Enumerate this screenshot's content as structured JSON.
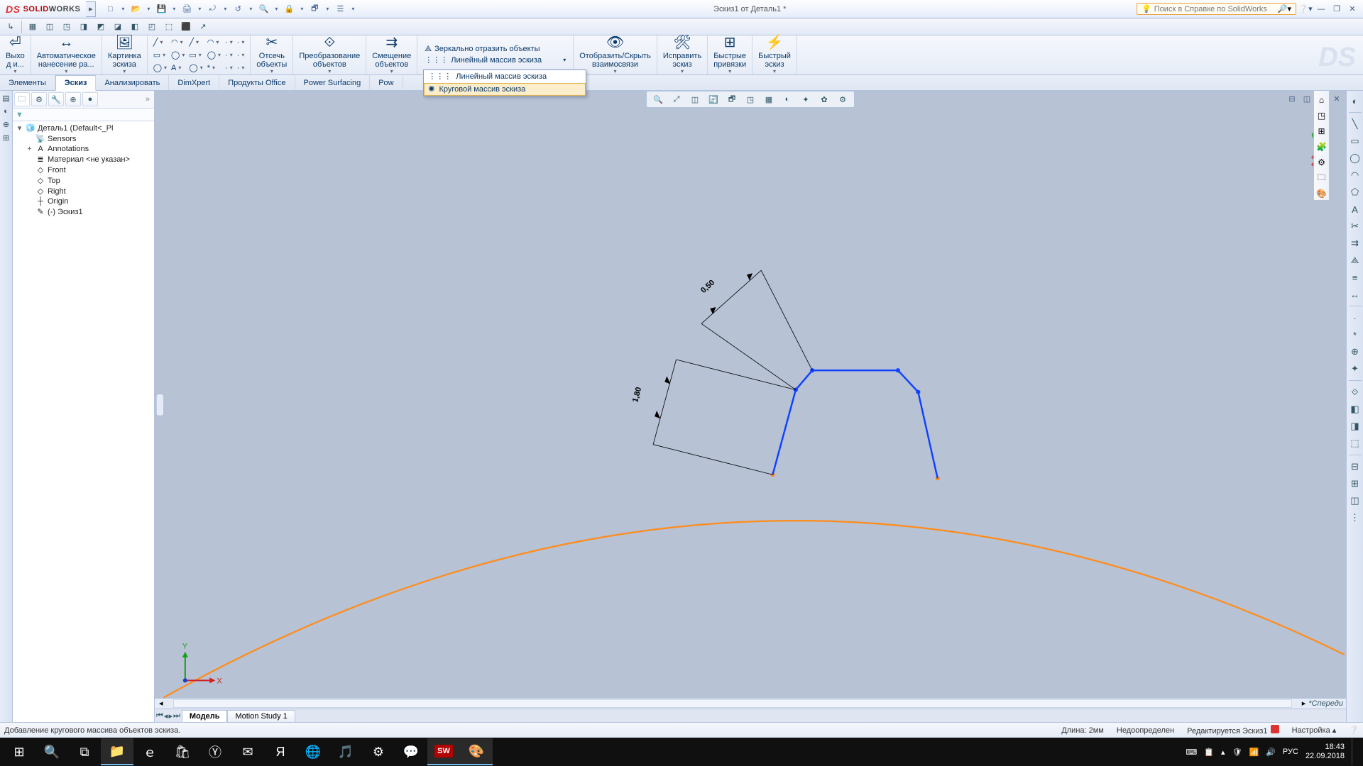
{
  "app": {
    "name_a": "SOLID",
    "name_b": "WORKS",
    "doc": "Эскиз1 от Деталь1 *",
    "search_prompt": "Поиск в Справке по SolidWorks"
  },
  "qat_icons": [
    "□",
    "📂",
    "💾",
    "🖨",
    "⤾",
    "↺",
    "🔍",
    "🔒",
    "🗗",
    "☰"
  ],
  "minibar_icons": [
    "↳",
    "▦",
    "◫",
    "◳",
    "◨",
    "◩",
    "◪",
    "◧",
    "◰",
    "⬚",
    "⬛",
    "↗"
  ],
  "ribbon": {
    "big": [
      {
        "ic": "⏎",
        "l": "Выхо\nд и..."
      },
      {
        "ic": "↔",
        "l": "Автоматическое\nнанесение ра..."
      },
      {
        "ic": "🖼",
        "l": "Картинка\nэскиза"
      }
    ],
    "sketch_tools": [
      [
        "╱",
        "▭",
        "◯",
        "◠",
        "◯",
        "A"
      ],
      [
        "╱",
        "▭",
        "◯",
        "◠",
        "◯",
        "*"
      ],
      [
        "·",
        "·",
        "·",
        "·",
        "·",
        "·"
      ]
    ],
    "mid": [
      {
        "ic": "✂",
        "l": "Отсечь\nобъекты"
      },
      {
        "ic": "⟐",
        "l": "Преобразование\nобъектов"
      },
      {
        "ic": "⇉",
        "l": "Смещение\nобъектов"
      }
    ],
    "pattern_rows": [
      {
        "ic": "⟁",
        "l": "Зеркально отразить объекты"
      },
      {
        "ic": "⋮⋮⋮",
        "l": "Линейный массив эскиза",
        "drop": true
      }
    ],
    "popup_items": [
      {
        "ic": "⋮⋮⋮",
        "l": "Линейный массив эскиза"
      },
      {
        "ic": "✺",
        "l": "Круговой массив эскиза",
        "sel": true
      }
    ],
    "right": [
      {
        "ic": "👁",
        "l": "Отобразить/Скрыть\nвзаимосвязи"
      },
      {
        "ic": "🛠",
        "l": "Исправить\nэскиз"
      },
      {
        "ic": "⊞",
        "l": "Быстрые\nпривязки"
      },
      {
        "ic": "⚡",
        "l": "Быстрый\nэскиз"
      }
    ]
  },
  "rtabs": [
    "Элементы",
    "Эскиз",
    "Анализировать",
    "DimXpert",
    "Продукты Office",
    "Power Surfacing",
    "Pow"
  ],
  "rtab_active": 1,
  "fm_tabs_icons": [
    "🗀",
    "⚙",
    "🔧",
    "⊕",
    "●"
  ],
  "tree": {
    "root": "Деталь1  (Default<<Default>_Pl",
    "children": [
      {
        "ic": "📡",
        "l": "Sensors"
      },
      {
        "ic": "A",
        "l": "Annotations",
        "exp": "+"
      },
      {
        "ic": "≣",
        "l": "Материал <не указан>"
      },
      {
        "ic": "◇",
        "l": "Front"
      },
      {
        "ic": "◇",
        "l": "Top"
      },
      {
        "ic": "◇",
        "l": "Right"
      },
      {
        "ic": "┼",
        "l": "Origin"
      },
      {
        "ic": "✎",
        "l": "(-) Эскиз1"
      }
    ]
  },
  "heads_up": [
    "🔍",
    "⤢",
    "◫",
    "🔄",
    "🗗",
    "◳",
    "▦",
    "◐",
    "✦",
    "✿",
    "⚙"
  ],
  "doc_win": [
    "⊟",
    "◫",
    "⟷",
    "✕"
  ],
  "dims": {
    "d1": "1,80",
    "d2": "0,50"
  },
  "taskpane": [
    "⌂",
    "◳",
    "⊞",
    "🧩",
    "⚙",
    "🗀",
    "🎨"
  ],
  "rightstrip": [
    "◐",
    "╲",
    "▭",
    "◯",
    "◠",
    "⬠",
    "A",
    "✂",
    "⇉",
    "⟁",
    "≡",
    "↔",
    "·",
    "*",
    "⊕",
    "✦",
    "⟐",
    "◧",
    "◨",
    "⬚",
    "⊟",
    "⊞",
    "◫",
    "⋮"
  ],
  "triad": "*Спереди",
  "model_tabs": [
    "Модель",
    "Motion Study 1"
  ],
  "status": {
    "msg": "Добавление кругового массива объектов эскиза.",
    "len": "Длина: 2мм",
    "under": "Недоопределен",
    "edit": "Редактируется Эскиз1",
    "opt": "Настройка  ▴",
    "help": "❔"
  },
  "taskbar": {
    "btns": [
      "⊞",
      "🔍",
      "⧉",
      "📁",
      "ｅ",
      "🛍",
      "Ⓨ",
      "✉",
      "Я",
      "🌐",
      "🎵",
      "⚙",
      "💬",
      "SW",
      "🎨"
    ],
    "active": [
      false,
      false,
      false,
      true,
      false,
      false,
      false,
      false,
      false,
      false,
      false,
      false,
      false,
      true,
      true
    ],
    "tray": [
      "📋",
      "▴",
      "🛡",
      "📶",
      "🔊",
      "РУС"
    ],
    "tray_extra": "⌨",
    "time": "18:43",
    "date": "22.09.2018"
  }
}
